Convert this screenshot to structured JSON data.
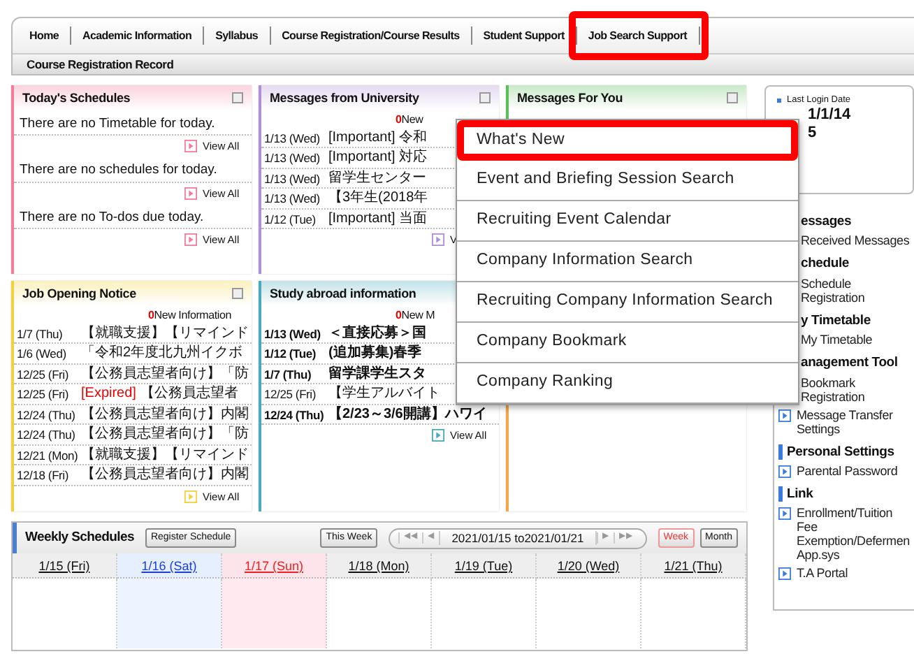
{
  "nav": {
    "tabs": [
      {
        "label": "Home",
        "highlighted": false
      },
      {
        "label": "Academic Information",
        "highlighted": false
      },
      {
        "label": "Syllabus",
        "highlighted": false
      },
      {
        "label": "Course Registration/Course Results",
        "highlighted": false
      },
      {
        "label": "Student Support",
        "highlighted": false
      },
      {
        "label": "Job Search Support",
        "highlighted": true
      }
    ],
    "subtabs": [
      {
        "label": "Course Registration Record"
      }
    ]
  },
  "panels": [
    {
      "kind": "schedule",
      "title": "Today's Schedules",
      "color": "#f27c9a",
      "entries": [
        {
          "text": "There are no Timetable for today.",
          "link": "View All"
        },
        {
          "text": "There are no schedules for today.",
          "link": "View All"
        },
        {
          "text": "There are no To-dos due today.",
          "link": "View All"
        }
      ]
    },
    {
      "kind": "messages",
      "title": "Messages from University",
      "color": "#b08fd6",
      "new_count": "0",
      "new_label": "New",
      "link": "V",
      "rows": [
        {
          "date": "1/13 (Wed)",
          "text": "[Important] 令和",
          "unread": false
        },
        {
          "date": "1/13 (Wed)",
          "text": "[Important] 対応",
          "unread": false
        },
        {
          "date": "1/13 (Wed)",
          "text": "留学生センター",
          "unread": false
        },
        {
          "date": "1/13 (Wed)",
          "text": "【3年生(2018年",
          "unread": false
        },
        {
          "date": "1/12 (Tue)",
          "text": "[Important] 当面",
          "unread": false
        }
      ]
    },
    {
      "kind": "header_only",
      "title": "Messages For You",
      "color": "#5cbf5c"
    },
    {
      "kind": "messages",
      "title": "Job Opening Notice",
      "color": "#f2d23c",
      "new_count": "0",
      "new_label": "New Information",
      "link": "View All",
      "rows": [
        {
          "date": "1/7 (Thu)",
          "text": "【就職支援】【リマインド",
          "unread": false
        },
        {
          "date": "1/6 (Wed)",
          "text": "「令和2年度北九州イクボ",
          "unread": false
        },
        {
          "date": "12/25 (Fri)",
          "text": "【公務員志望者向け】「防",
          "unread": false
        },
        {
          "date": "12/25 (Fri)",
          "label": "[Expired]",
          "text": "【公務員志望者",
          "unread": false
        },
        {
          "date": "12/24 (Thu)",
          "text": "【公務員志望者向け】内閣",
          "unread": false
        },
        {
          "date": "12/24 (Thu)",
          "text": "【公務員志望者向け】「防",
          "unread": false
        },
        {
          "date": "12/21 (Mon)",
          "text": "【就職支援】【リマインド",
          "unread": false
        },
        {
          "date": "12/18 (Fri)",
          "text": "【公務員志望者向け】内閣",
          "unread": false
        }
      ]
    },
    {
      "kind": "messages",
      "title": "Study abroad information",
      "color": "#4aaabb",
      "new_count": "0",
      "new_label": "New M",
      "link": "View All",
      "rows": [
        {
          "date": "1/13 (Wed)",
          "text": "＜直接応募＞国",
          "unread": true
        },
        {
          "date": "1/12 (Tue)",
          "text": "(追加募集)春季",
          "unread": true
        },
        {
          "date": "1/7 (Thu)",
          "text": "留学課学生スタ",
          "unread": true
        },
        {
          "date": "12/25 (Fri)",
          "text": "【学生アルバイト",
          "unread": false
        },
        {
          "date": "12/24 (Thu)",
          "text": "【2/23～3/6開講】ハワイ",
          "unread": true
        }
      ]
    },
    {
      "kind": "blank",
      "color": "#f5a54a"
    }
  ],
  "dropdown": {
    "items": [
      {
        "label": "What's New",
        "highlighted": true
      },
      {
        "label": "Event and Briefing Session Search",
        "highlighted": false
      },
      {
        "label": "Recruiting Event Calendar",
        "highlighted": false
      },
      {
        "label": "Company Information Search",
        "highlighted": false
      },
      {
        "label": "Recruiting Company Information Search",
        "highlighted": false
      },
      {
        "label": "Company Bookmark",
        "highlighted": false
      },
      {
        "label": "Company Ranking",
        "highlighted": false
      }
    ]
  },
  "last_login": {
    "label": "Last Login Date",
    "lines": [
      "1/1/14",
      "5"
    ]
  },
  "sidebar": {
    "entries": [
      {
        "kind": "heading",
        "text": "essages",
        "cut": true
      },
      {
        "kind": "link",
        "text": "Received Messages",
        "cut": true
      },
      {
        "kind": "heading",
        "text": "chedule",
        "cut": true
      },
      {
        "kind": "link",
        "text": "Schedule Registration",
        "cut": true
      },
      {
        "kind": "heading",
        "text": "y Timetable",
        "cut": true
      },
      {
        "kind": "link",
        "text": "My Timetable",
        "cut": true
      },
      {
        "kind": "heading",
        "text": "anagement Tool",
        "cut": true
      },
      {
        "kind": "link",
        "text": "Bookmark Registration",
        "cut": true
      },
      {
        "kind": "link",
        "text": "Message Transfer Settings",
        "cut": false
      },
      {
        "kind": "heading",
        "text": "Personal Settings",
        "cut": false
      },
      {
        "kind": "link",
        "text": "Parental Password",
        "cut": false
      },
      {
        "kind": "heading",
        "text": "Link",
        "cut": false
      },
      {
        "kind": "link",
        "text": "Enrollment/Tuition Fee Exemption/Defermen App.sys",
        "cut": false
      },
      {
        "kind": "link",
        "text": "T.A Portal",
        "cut": false
      }
    ]
  },
  "weekly": {
    "title": "Weekly Schedules",
    "register": "Register Schedule",
    "this_week": "This Week",
    "pager": {
      "first": "◀◀",
      "prev": "◀",
      "range": "2021/01/15 to2021/01/21",
      "next": "▶",
      "last": "▶▶"
    },
    "views": [
      {
        "label": "Week",
        "selected": true
      },
      {
        "label": "Month",
        "selected": false
      }
    ],
    "days": [
      {
        "label": "1/15 (Fri)",
        "kind": "weekday"
      },
      {
        "label": "1/16 (Sat)",
        "kind": "sat"
      },
      {
        "label": "1/17 (Sun)",
        "kind": "sun"
      },
      {
        "label": "1/18 (Mon)",
        "kind": "weekday"
      },
      {
        "label": "1/19 (Tue)",
        "kind": "weekday"
      },
      {
        "label": "1/20 (Wed)",
        "kind": "weekday"
      },
      {
        "label": "1/21 (Thu)",
        "kind": "weekday"
      }
    ]
  }
}
